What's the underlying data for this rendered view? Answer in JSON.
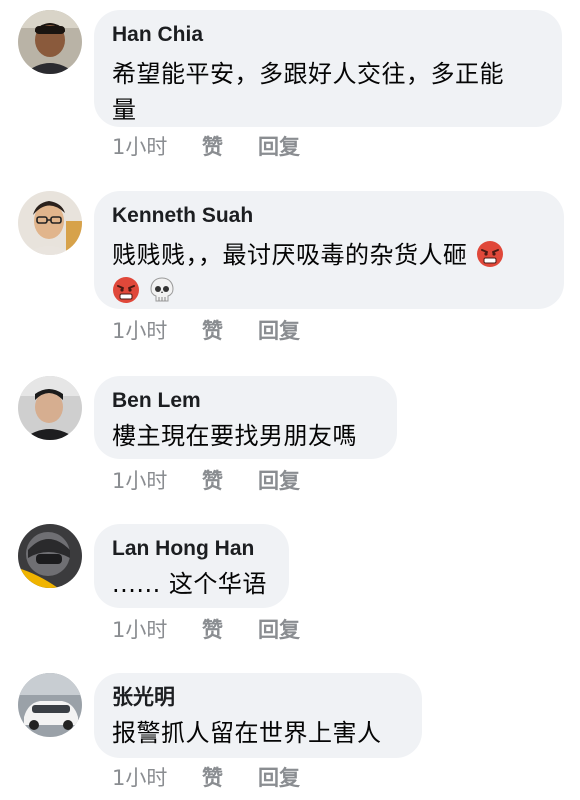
{
  "comments": [
    {
      "author": "Han Chia",
      "text_line1": "希望能平安，多跟好人交往，多正能",
      "text_line2": "量",
      "time": "1小时",
      "like_label": "赞",
      "reply_label": "回复"
    },
    {
      "author": "Kenneth Suah",
      "text_line1": "贱贱贱，，最讨厌吸毒的杂货人砸",
      "time": "1小时",
      "like_label": "赞",
      "reply_label": "回复",
      "emojis": [
        "angry-face-emoji",
        "angry-face-emoji",
        "skull-emoji"
      ]
    },
    {
      "author": "Ben Lem",
      "text_line1": "樓主現在要找男朋友嗎",
      "time": "1小时",
      "like_label": "赞",
      "reply_label": "回复"
    },
    {
      "author": "Lan Hong Han",
      "text_line1": "...... 这个华语",
      "time": "1小时",
      "like_label": "赞",
      "reply_label": "回复"
    },
    {
      "author": "张光明",
      "text_line1": "报警抓人留在世界上害人",
      "time": "1小时",
      "like_label": "赞",
      "reply_label": "回复"
    }
  ],
  "colors": {
    "bubble_bg": "#f0f2f5",
    "meta_text": "#8a8d91",
    "author_text": "#1c1e21"
  }
}
